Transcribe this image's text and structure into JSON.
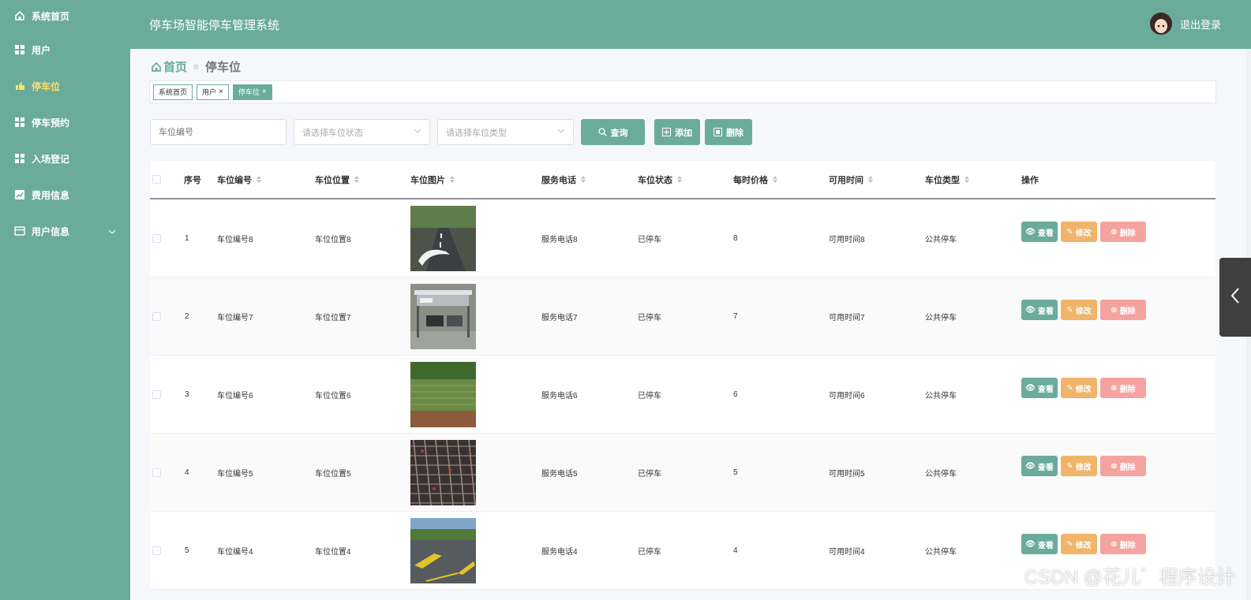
{
  "sidebar": {
    "items": [
      {
        "label": "系统首页",
        "icon": "home-icon"
      },
      {
        "label": "用户",
        "icon": "grid-icon"
      },
      {
        "label": "停车位",
        "icon": "parking-icon"
      },
      {
        "label": "停车预约",
        "icon": "grid-icon"
      },
      {
        "label": "入场登记",
        "icon": "grid-icon"
      },
      {
        "label": "费用信息",
        "icon": "chart-icon"
      },
      {
        "label": "用户信息",
        "icon": "card-icon"
      }
    ],
    "active_index": 2
  },
  "header": {
    "title": "停车场智能停车管理系统",
    "logout_label": "退出登录"
  },
  "breadcrumb": {
    "home": "首页",
    "current": "停车位"
  },
  "tags": [
    {
      "label": "系统首页",
      "closable": false
    },
    {
      "label": "用户",
      "closable": true
    },
    {
      "label": "停车位",
      "closable": true
    }
  ],
  "search": {
    "code_placeholder": "车位编号",
    "status_placeholder": "请选择车位状态",
    "type_placeholder": "请选择车位类型",
    "query_label": "查询",
    "add_label": "添加",
    "delete_label": "删除"
  },
  "table": {
    "columns": [
      "序号",
      "车位编号",
      "车位位置",
      "车位图片",
      "服务电话",
      "车位状态",
      "每时价格",
      "可用时间",
      "车位类型",
      "操作"
    ],
    "rows": [
      {
        "index": "1",
        "code": "车位编号8",
        "location": "车位位置8",
        "phone": "服务电话8",
        "status": "已停车",
        "price": "8",
        "time": "可用时间8",
        "type": "公共停车"
      },
      {
        "index": "2",
        "code": "车位编号7",
        "location": "车位位置7",
        "phone": "服务电话7",
        "status": "已停车",
        "price": "7",
        "time": "可用时间7",
        "type": "公共停车"
      },
      {
        "index": "3",
        "code": "车位编号6",
        "location": "车位位置6",
        "phone": "服务电话6",
        "status": "已停车",
        "price": "6",
        "time": "可用时间6",
        "type": "公共停车"
      },
      {
        "index": "4",
        "code": "车位编号5",
        "location": "车位位置5",
        "phone": "服务电话5",
        "status": "已停车",
        "price": "5",
        "time": "可用时间5",
        "type": "公共停车"
      },
      {
        "index": "5",
        "code": "车位编号4",
        "location": "车位位置4",
        "phone": "服务电话4",
        "status": "已停车",
        "price": "4",
        "time": "可用时间4",
        "type": "公共停车"
      }
    ],
    "action_labels": {
      "view": "查看",
      "edit": "修改",
      "delete": "删除"
    }
  },
  "watermark": "CSDN @花儿゛程序设计",
  "colors": {
    "primary": "#6aab9c",
    "edit": "#f0b56a",
    "delete": "#f5a3a0",
    "active_menu": "#ffe066"
  }
}
